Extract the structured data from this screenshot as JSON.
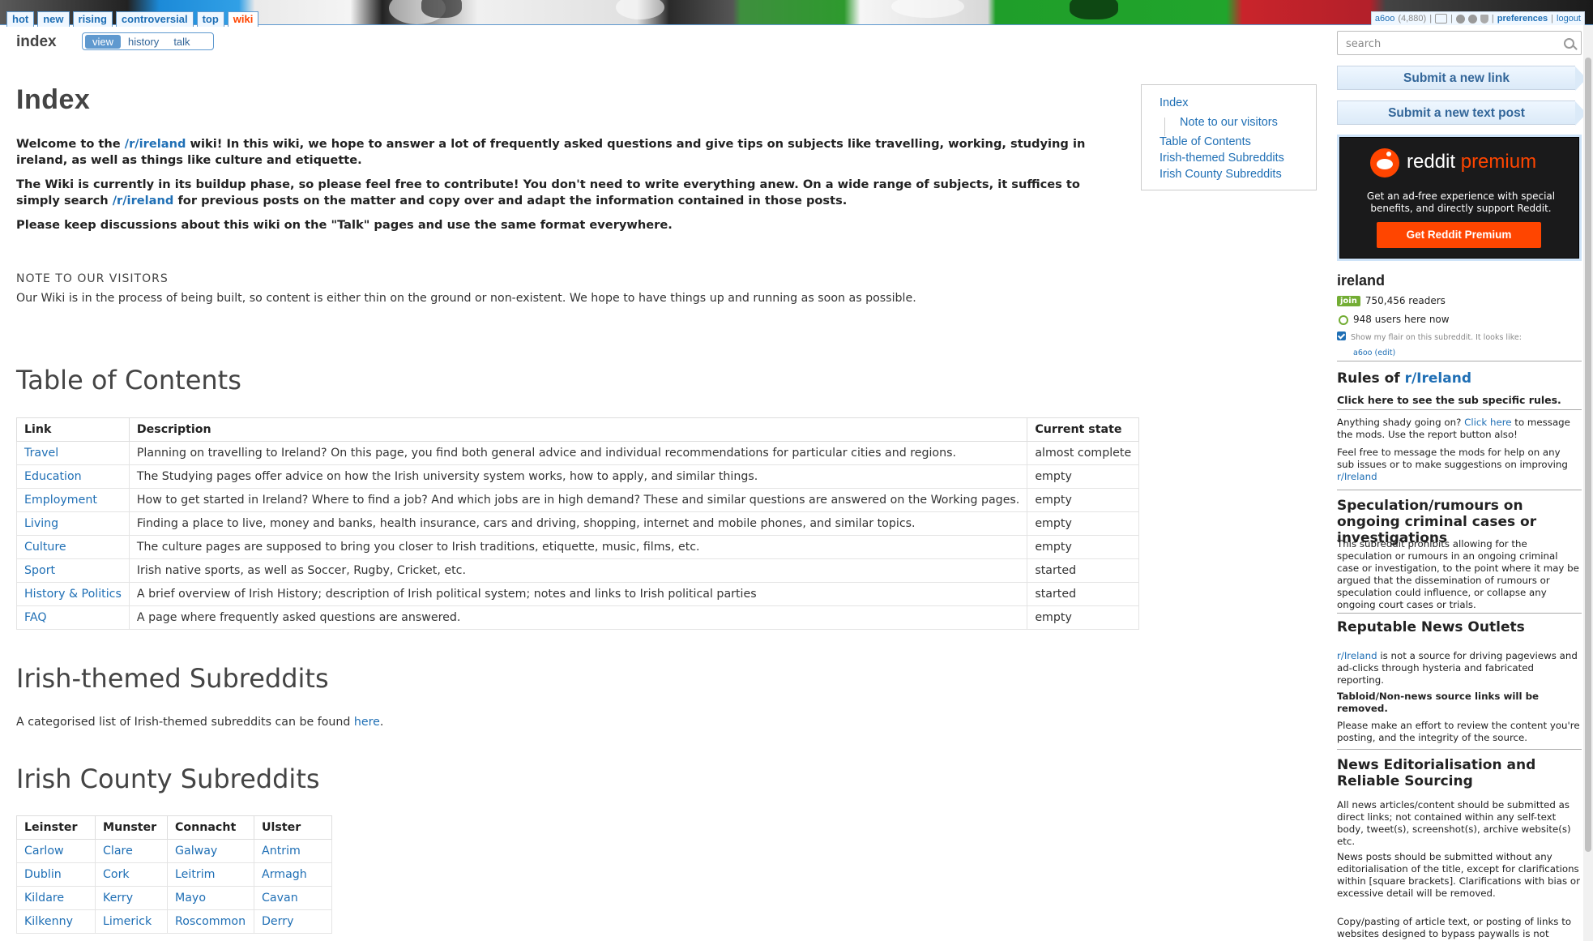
{
  "header": {
    "tabs": [
      "hot",
      "new",
      "rising",
      "controversial",
      "top",
      "wiki"
    ],
    "selected_tab": "wiki",
    "user": {
      "name": "a6oo",
      "karma": "(4,880)",
      "separator": "|",
      "preferences": "preferences",
      "logout": "logout"
    }
  },
  "wiki": {
    "page_label": "index",
    "tabs": {
      "view": "view",
      "history": "history",
      "talk": "talk"
    },
    "title": "Index",
    "intro1": {
      "a": "Welcome to the ",
      "link": "/r/ireland",
      "b": " wiki! In this wiki, we hope to answer a lot of frequently asked questions and give tips on subjects like travelling, working, studying in ireland, as well as things like culture and etiquette."
    },
    "intro2": {
      "a": "The Wiki is currently in its buildup phase, so please feel free to contribute! You don't need to write everything anew. On a wide range of subjects, it suffices to simply search ",
      "link": "/r/ireland",
      "b": " for previous posts on the matter and copy over and adapt the information contained in those posts."
    },
    "intro3": "Please keep discussions about this wiki on the \"Talk\" pages and use the same format everywhere.",
    "visitors_heading": "NOTE TO OUR VISITORS",
    "visitors_text": "Our Wiki is in the process of being built, so content is either thin on the ground or non-existent. We hope to have things up and running as soon as possible.",
    "toc": [
      "Index",
      "Note to our visitors",
      "Table of Contents",
      "Irish-themed Subreddits",
      "Irish County Subreddits"
    ],
    "toc_heading": "Table of Contents",
    "toc_table": {
      "headers": [
        "Link",
        "Description",
        "Current state"
      ],
      "rows": [
        [
          "Travel",
          "Planning on travelling to Ireland? On this page, you find both general advice and individual recommendations for particular cities and regions.",
          "almost complete"
        ],
        [
          "Education",
          "The Studying pages offer advice on how the Irish university system works, how to apply, and similar things.",
          "empty"
        ],
        [
          "Employment",
          "How to get started in Ireland? Where to find a job? And which jobs are in high demand? These and similar questions are answered on the Working pages.",
          "empty"
        ],
        [
          "Living",
          "Finding a place to live, money and banks, health insurance, cars and driving, shopping, internet and mobile phones, and similar topics.",
          "empty"
        ],
        [
          "Culture",
          "The culture pages are supposed to bring you closer to Irish traditions, etiquette, music, films, etc.",
          "empty"
        ],
        [
          "Sport",
          "Irish native sports, as well as Soccer, Rugby, Cricket, etc.",
          "started"
        ],
        [
          "History & Politics",
          "A brief overview of Irish History; description of Irish political system; notes and links to Irish political parties",
          "started"
        ],
        [
          "FAQ",
          "A page where frequently asked questions are answered.",
          "empty"
        ]
      ]
    },
    "themed_heading": "Irish-themed Subreddits",
    "themed_text": "A categorised list of Irish-themed subreddits can be found ",
    "themed_link": "here",
    "themed_end": ".",
    "county_heading": "Irish County Subreddits",
    "county_table": {
      "headers": [
        "Leinster",
        "Munster",
        "Connacht",
        "Ulster"
      ],
      "rows": [
        [
          "Carlow",
          "Clare",
          "Galway",
          "Antrim"
        ],
        [
          "Dublin",
          "Cork",
          "Leitrim",
          "Armagh"
        ],
        [
          "Kildare",
          "Kerry",
          "Mayo",
          "Cavan"
        ],
        [
          "Kilkenny",
          "Limerick",
          "Roscommon",
          "Derry"
        ]
      ]
    }
  },
  "sidebar": {
    "search_placeholder": "search",
    "submit_link": "Submit a new link",
    "submit_text": "Submit a new text post",
    "premium": {
      "brand_a": "reddit",
      "brand_b": "premium",
      "desc": "Get an ad-free experience with special benefits, and directly support Reddit.",
      "cta": "Get Reddit Premium"
    },
    "subreddit": "ireland",
    "join": "join",
    "readers": "750,456 readers",
    "online": "948 users here now",
    "flair_text": "Show my flair on this subreddit. It looks like:",
    "flair_user": "a6oo",
    "flair_edit": "(edit)",
    "rules_title_a": "Rules of ",
    "rules_title_link": "r/Ireland",
    "rules_link": "Click here to see the sub specific rules.",
    "shady_a": "Anything shady going on? ",
    "shady_link": "Click here",
    "shady_b": " to message the mods. Use the report button also!",
    "feel_free_a": "Feel free to message the mods for help on any sub issues or to make suggestions on improving ",
    "feel_free_link": "r/Ireland",
    "spec_title": "Speculation/rumours on ongoing criminal cases or investigations",
    "spec_text": "This subreddit prohibits allowing for the speculation or rumours in an ongoing criminal case or investigation, to the point where it may be argued that the dissemination of rumours or speculation could influence, or collapse any ongoing court cases or trials.",
    "news_title": "Reputable News Outlets",
    "news_link": "r/Ireland",
    "news_text": " is not a source for driving pageviews and ad-clicks through hysteria and fabricated reporting.",
    "news_bold": "Tabloid/Non-news source links will be removed.",
    "news_text2": "Please make an effort to review the content you're posting, and the integrity of the source.",
    "edit_title": "News Editorialisation and Reliable Sourcing",
    "edit_text1": "All news articles/content should be submitted as direct links; not contained within any self-text body, tweet(s), screenshot(s), archive website(s) etc.",
    "edit_text2": "News posts should be submitted without any editorialisation of the title, except for clarifications within [square brackets]. Clarifications with bias or excessive detail will be removed.",
    "edit_text3": "Copy/pasting of article text, or posting of links to websites designed to bypass paywalls is not"
  }
}
